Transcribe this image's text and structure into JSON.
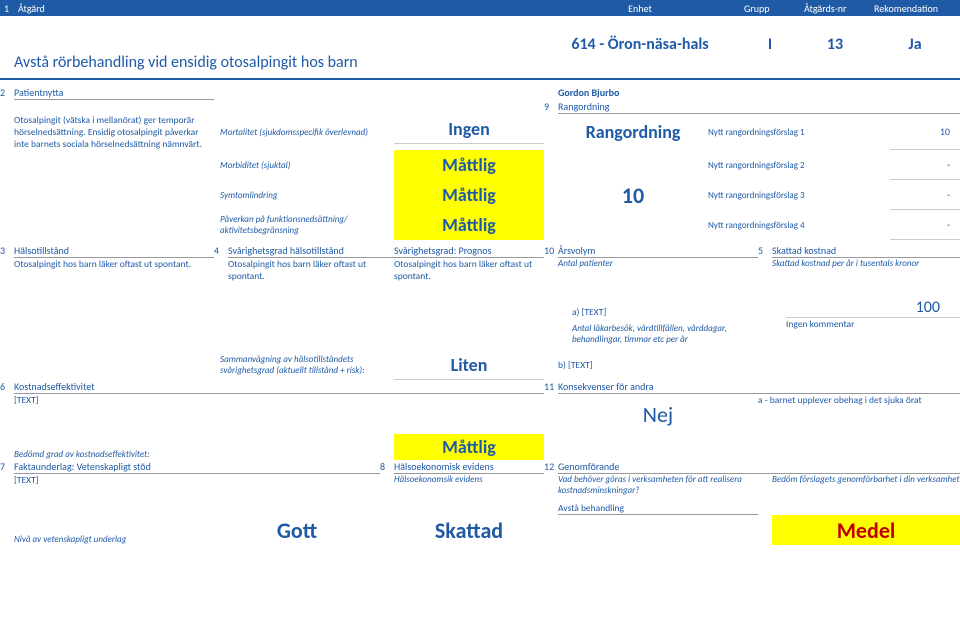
{
  "header": {
    "n1": "1",
    "atgard": "Åtgärd",
    "enhet": "Enhet",
    "grupp": "Grupp",
    "atgardsnr": "Åtgärds-nr",
    "rekomendation": "Rekomendation"
  },
  "title": "Avstå rörbehandling vid ensidig otosalpingit hos barn",
  "enhet_value": "614 - Öron-näsa-hals",
  "grupp_value": "I",
  "atgardsnr_value": "13",
  "rekomendation_value": "Ja",
  "section2": {
    "num": "2",
    "label": "Patientnytta"
  },
  "person": "Gordon Bjurbo",
  "section9": {
    "num": "9",
    "label": "Rangordning"
  },
  "s2_body": "Otosalpingit (vätska i mellanörat) ger temporär hörselnedsättning. Ensidig otosalpingit påverkar inte barnets sociala hörselnedsättning nämnvärt.",
  "metrics": {
    "mortalitet": {
      "label": "Mortalitet (sjukdomsspecifik överlevnad)",
      "value": "Ingen"
    },
    "morbiditet": {
      "label": "Morbiditet (sjuktal)",
      "value": "Måttlig"
    },
    "symtom": {
      "label": "Symtomlindring",
      "value": "Måttlig"
    },
    "paverkan": {
      "label": "Påverkan på funktionsnedsättning/ aktivitetsbegränsning",
      "value": "Måttlig"
    }
  },
  "ranking": {
    "heading": "Rangordning",
    "score": "10",
    "row1": {
      "label": "Nytt rangordningsförslag 1",
      "value": "10"
    },
    "row2": {
      "label": "Nytt rangordningsförslag 2",
      "value": "-"
    },
    "row3": {
      "label": "Nytt rangordningsförslag 3",
      "value": "-"
    },
    "row4": {
      "label": "Nytt rangordningsförslag 4",
      "value": "-"
    }
  },
  "section3": {
    "num": "3",
    "label": "Hälsotillstånd",
    "body": "Otosalpingit hos barn läker oftast ut spontant."
  },
  "section4": {
    "num": "4",
    "label": "Svårighetsgrad hälsotillstånd",
    "body": "Otosalpingit hos barn läker oftast ut spontant."
  },
  "prognos": {
    "label": "Svårighetsgrad: Prognos",
    "body": "Otosalpingit hos barn läker oftast ut spontant."
  },
  "section10": {
    "num": "10",
    "label": "Årsvolym",
    "antal": "Antal patienter",
    "a": "a) [TEXT]",
    "visits": "Antal läkarbesök, vårdtillfällen, vårddagar, behandlingar, timmar etc per år",
    "b": "b) [TEXT]"
  },
  "section5": {
    "num": "5",
    "label": "Skattad kostnad",
    "per_ar": "Skattad kostnad per år i tusentals kronor",
    "value": "100",
    "komment": "Ingen kommentar"
  },
  "sammanvagning": {
    "label": "Sammanvägning av hälsotillståndets svårighetsgrad (aktuellt tillstånd + risk):",
    "value": "Liten"
  },
  "section6": {
    "num": "6",
    "label": "Kostnadseffektivitet",
    "body": "[TEXT]",
    "bedomd": "Bedömd grad av kostnadseffektivitet:",
    "value": "Måttlig"
  },
  "section11": {
    "num": "11",
    "label": "Konsekvenser för andra",
    "value": "Nej",
    "note": "a - barnet upplever obehag i det sjuka örat"
  },
  "section7": {
    "num": "7",
    "label": "Faktaunderlag: Vetenskapligt stöd",
    "body": "[TEXT]",
    "niva": "Nivå av vetenskapligt underlag",
    "value": "Gott"
  },
  "section8": {
    "num": "8",
    "label": "Hälsoekonomisk evidens",
    "body": "Hälsoekonomsik evidens",
    "value": "Skattad"
  },
  "section12": {
    "num": "12",
    "label": "Genomförande",
    "body": "Vad behöver göras i verksamheten för att realisera kostnadsminskningar?",
    "avsta": "Avstå behandling"
  },
  "bedom": {
    "label": "Bedöm förslagets genomförbarhet i din verksamhet",
    "value": "Medel"
  }
}
